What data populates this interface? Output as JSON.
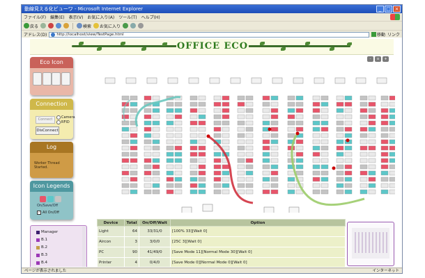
{
  "window": {
    "title": "動線見える化ビューワ - Microsoft Internet Explorer",
    "menu": [
      "ファイル(F)",
      "編集(E)",
      "表示(V)",
      "お気に入り(A)",
      "ツール(T)",
      "ヘルプ(H)"
    ],
    "toolbar": [
      "戻る",
      "検索",
      "お気に入り"
    ],
    "address_label": "アドレス(D)",
    "address": "http://localhost/view/TestPage.html",
    "go_label": "移動",
    "links_label": "リンク",
    "status_text": "ページが表示されました",
    "status_zone": "インターネット"
  },
  "app": {
    "logo_text": "OFFICE ECO",
    "eco_icon": {
      "title": "Eco Icon"
    },
    "connection": {
      "title": "Connection",
      "connect_button": "Connect",
      "disconnect_button": "DisConnect",
      "options": [
        "Camera",
        "RFID"
      ]
    },
    "log": {
      "title": "Log",
      "text": "Worker Thread Started."
    },
    "icon_legends": {
      "title": "Icon Legends",
      "on_off_label": "On/Save/Off",
      "all_label": "All On/Off",
      "all_checked": true
    },
    "groups": [
      {
        "label": "Manager",
        "color": "#3b1f6e"
      },
      {
        "label": "B.1",
        "color": "#9b38b6"
      },
      {
        "label": "B.2",
        "color": "#c3a04a"
      },
      {
        "label": "B.3",
        "color": "#9b38b6"
      },
      {
        "label": "B.4",
        "color": "#9b38b6"
      }
    ],
    "table": {
      "headers": [
        "Device",
        "Total",
        "On/Off/Wait",
        "Option"
      ],
      "rows": [
        {
          "device": "Light",
          "total": "64",
          "state": "33/31/0",
          "option": "[100% 33][Wait 0]"
        },
        {
          "device": "Aircon",
          "total": "3",
          "state": "3/0/0",
          "option": "[25C 3][Wait 0]"
        },
        {
          "device": "PC",
          "total": "90",
          "state": "41/49/0",
          "option": "[Save Mode 11][Normal Mode 30][Wait 0]"
        },
        {
          "device": "Printer",
          "total": "4",
          "state": "0/4/0",
          "option": "[Save Mode 0][Normal Mode 0][Wait 0]"
        }
      ]
    }
  },
  "colors": {
    "eco_header": "#c9625a",
    "connection_header": "#cfb84a",
    "log_header": "#a87623",
    "legend_header": "#4f98a0",
    "desk_on": "#e8556a",
    "desk_save": "#5dc7c9",
    "desk_off": "#c4c4c4",
    "path_red": "#d0323f",
    "path_green": "#9ccc6a",
    "path_teal": "#6cc8bf"
  }
}
